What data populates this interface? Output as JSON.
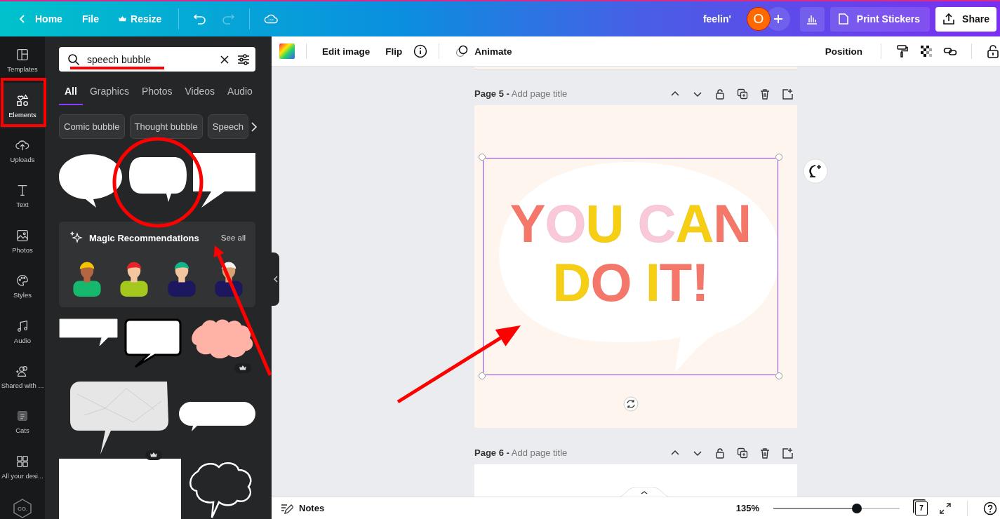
{
  "topbar": {
    "back": "Home",
    "menus": [
      "File",
      "Resize"
    ],
    "doc_title": "feelin'",
    "avatar": "O",
    "print": "Print Stickers",
    "share": "Share"
  },
  "rail": [
    {
      "label": "Templates",
      "selected": false
    },
    {
      "label": "Elements",
      "selected": true
    },
    {
      "label": "Uploads",
      "selected": false
    },
    {
      "label": "Text",
      "selected": false
    },
    {
      "label": "Photos",
      "selected": false
    },
    {
      "label": "Styles",
      "selected": false
    },
    {
      "label": "Audio",
      "selected": false
    },
    {
      "label": "Shared with ...",
      "selected": false
    },
    {
      "label": "Cats",
      "selected": false
    },
    {
      "label": "All your desi...",
      "selected": false
    }
  ],
  "brand_logo": "CO.",
  "search": {
    "value": "speech bubble"
  },
  "tabs": [
    {
      "label": "All",
      "selected": true
    },
    {
      "label": "Graphics",
      "selected": false
    },
    {
      "label": "Photos",
      "selected": false
    },
    {
      "label": "Videos",
      "selected": false
    },
    {
      "label": "Audio",
      "selected": false
    }
  ],
  "chips": [
    "Comic bubble",
    "Thought bubble",
    "Speech"
  ],
  "magic": {
    "title": "Magic Recommendations",
    "see_all": "See all"
  },
  "toolbar": {
    "edit_image": "Edit image",
    "flip": "Flip",
    "animate": "Animate",
    "position": "Position"
  },
  "pages": [
    {
      "label": "Page 5 -",
      "title_placeholder": "Add page title",
      "design": {
        "lines": [
          "YOU CAN",
          "DO IT!"
        ]
      }
    },
    {
      "label": "Page 6 -",
      "title_placeholder": "Add page title"
    }
  ],
  "bottom": {
    "notes": "Notes",
    "zoom": "135%",
    "zoom_slider": {
      "level": 0.66
    },
    "page_count": "7"
  },
  "annotations": [
    {
      "kind": "box"
    },
    {
      "kind": "underline"
    },
    {
      "kind": "circle"
    },
    {
      "kind": "arrow"
    },
    {
      "kind": "arrow"
    }
  ]
}
